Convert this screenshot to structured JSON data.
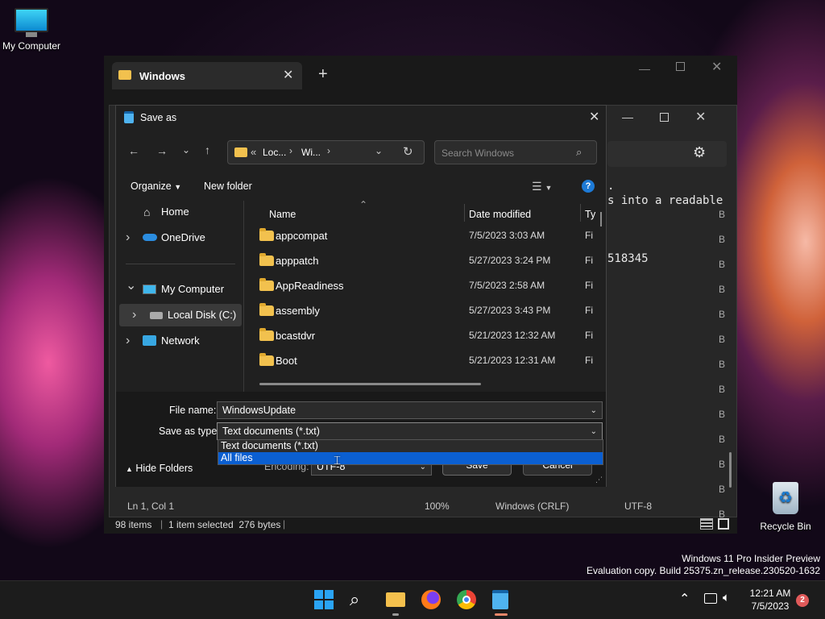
{
  "desktop": {
    "my_computer": "My Computer",
    "recycle_bin": "Recycle Bin",
    "watermark_line1": "Windows 11 Pro Insider Preview",
    "watermark_line2": "Evaluation copy. Build 25375.zn_release.230520-1632"
  },
  "explorer": {
    "tab_title": "Windows",
    "new_tab": "+",
    "status_items": "98 items",
    "status_selected": "1 item selected  276 bytes"
  },
  "notepad": {
    "line1": ".",
    "line2": "s into a readable",
    "line3": "518345",
    "status_pos": "Ln 1, Col 1",
    "status_zoom": "100%",
    "status_eol": "Windows (CRLF)",
    "status_enc": "UTF-8",
    "side_letters": [
      "B",
      "B",
      "B",
      "B",
      "B",
      "B",
      "B",
      "B",
      "B",
      "B",
      "B",
      "B",
      "B"
    ]
  },
  "dialog": {
    "title": "Save as",
    "address": {
      "prefix": "«",
      "seg1": "Loc...",
      "seg2": "Wi..."
    },
    "search_placeholder": "Search Windows",
    "organize": "Organize",
    "new_folder": "New folder",
    "sidebar": [
      {
        "label": "Home",
        "icon": "home-icon",
        "expander": ""
      },
      {
        "label": "OneDrive",
        "icon": "cloud-icon",
        "expander": "›"
      },
      {
        "label": "My Computer",
        "icon": "computer-icon",
        "expander": "⌄"
      },
      {
        "label": "Local Disk (C:)",
        "icon": "drive-icon",
        "expander": "›"
      },
      {
        "label": "Network",
        "icon": "network-icon",
        "expander": "›"
      }
    ],
    "columns": {
      "name": "Name",
      "date": "Date modified",
      "type": "Ty"
    },
    "files": [
      {
        "name": "appcompat",
        "date": "7/5/2023 3:03 AM",
        "type": "Fi"
      },
      {
        "name": "apppatch",
        "date": "5/27/2023 3:24 PM",
        "type": "Fi"
      },
      {
        "name": "AppReadiness",
        "date": "7/5/2023 2:58 AM",
        "type": "Fi"
      },
      {
        "name": "assembly",
        "date": "5/27/2023 3:43 PM",
        "type": "Fi"
      },
      {
        "name": "bcastdvr",
        "date": "5/21/2023 12:32 AM",
        "type": "Fi"
      },
      {
        "name": "Boot",
        "date": "5/21/2023 12:31 AM",
        "type": "Fi"
      }
    ],
    "file_name_label": "File name:",
    "file_name_value": "WindowsUpdate",
    "save_type_label": "Save as type:",
    "save_type_value": "Text documents (*.txt)",
    "type_options": [
      "Text documents (*.txt)",
      "All files"
    ],
    "encoding_label": "Encoding:",
    "encoding_value": "UTF-8",
    "hide_folders": "Hide Folders",
    "save": "Save",
    "cancel": "Cancel"
  },
  "taskbar": {
    "time": "12:21 AM",
    "date": "7/5/2023",
    "notification_count": "2"
  }
}
